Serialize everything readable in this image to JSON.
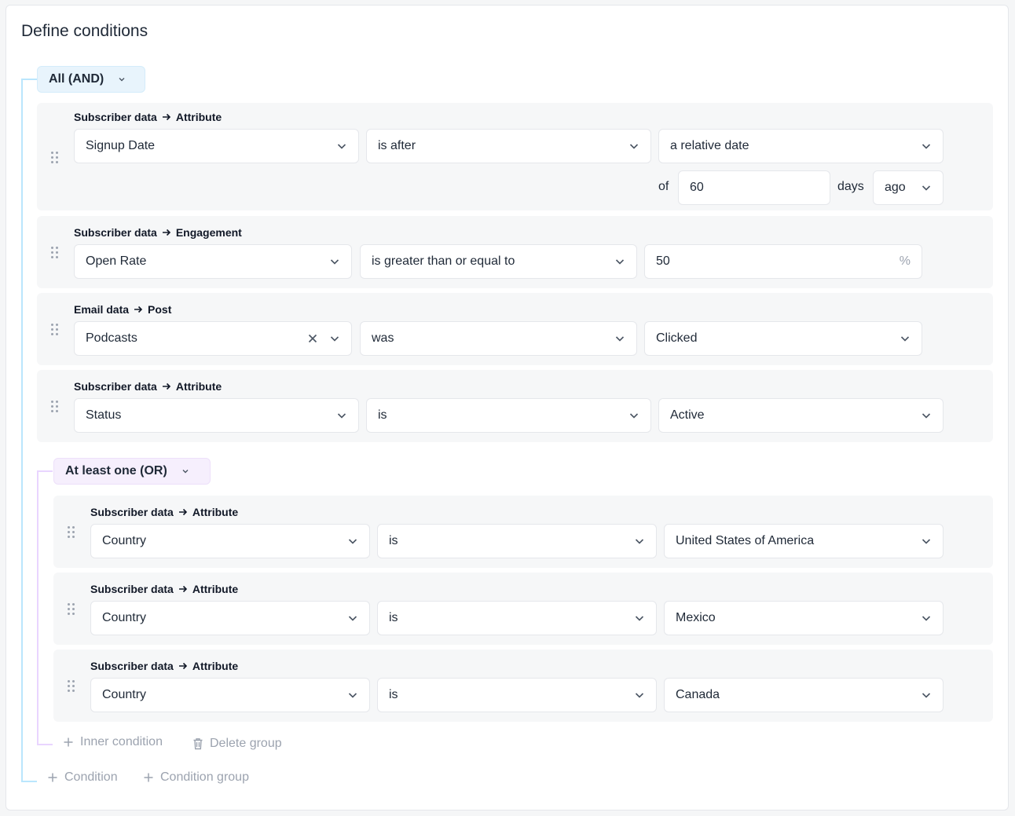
{
  "title": "Define conditions",
  "root_group": {
    "label": "All (AND)"
  },
  "conditions": [
    {
      "label_from": "Subscriber data",
      "label_to": "Attribute",
      "field": "Signup Date",
      "operator": "is after",
      "value": "a relative date",
      "extra": {
        "of": "of",
        "amount": "60",
        "unit": "days",
        "direction": "ago"
      }
    },
    {
      "label_from": "Subscriber data",
      "label_to": "Engagement",
      "field": "Open Rate",
      "operator": "is greater than or equal to",
      "value": "50",
      "suffix": "%"
    },
    {
      "label_from": "Email data",
      "label_to": "Post",
      "field": "Podcasts",
      "operator": "was",
      "value": "Clicked"
    },
    {
      "label_from": "Subscriber data",
      "label_to": "Attribute",
      "field": "Status",
      "operator": "is",
      "value": "Active"
    }
  ],
  "inner_group": {
    "label": "At least one (OR)",
    "conditions": [
      {
        "label_from": "Subscriber data",
        "label_to": "Attribute",
        "field": "Country",
        "operator": "is",
        "value": "United States of America"
      },
      {
        "label_from": "Subscriber data",
        "label_to": "Attribute",
        "field": "Country",
        "operator": "is",
        "value": "Mexico"
      },
      {
        "label_from": "Subscriber data",
        "label_to": "Attribute",
        "field": "Country",
        "operator": "is",
        "value": "Canada"
      }
    ],
    "actions": {
      "inner_condition": "Inner condition",
      "delete_group": "Delete group"
    }
  },
  "actions": {
    "condition": "Condition",
    "condition_group": "Condition group"
  }
}
